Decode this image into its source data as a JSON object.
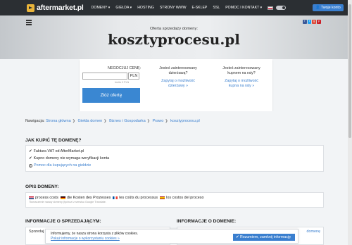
{
  "nav": {
    "logo_text": "aftermarket.pl",
    "menu": [
      "DOMENY",
      "GIEŁDA",
      "HOSTING",
      "STRONY WWW",
      "E-SKLEP",
      "SSL",
      "POMOC I KONTAKT"
    ],
    "login_label": "Twoje konto"
  },
  "hero": {
    "subtitle": "Oferta sprzedaży domeny:",
    "domain": "kosztyprocesu.pl"
  },
  "offer": {
    "price_label": "NEGOCJUJ CENĘ:",
    "price_value": "",
    "currency": "PLN",
    "price_note": "brutto 0 PLN",
    "submit_label": "Złóż ofertę",
    "lease": {
      "text_1": "Jesteś zainteresowany",
      "text_2": "dzierżawą?",
      "link_1": "Zapytaj o możliwość",
      "link_2": "dzierżawy »"
    },
    "installments": {
      "text_1": "Jesteś zainteresowany",
      "text_2": "kupnem na raty?",
      "link_1": "Zapytaj o możliwość",
      "link_2": "kupna na raty »"
    }
  },
  "breadcrumb": {
    "label": "Nawigacja:",
    "items": [
      "Strona główna",
      "Giełda domen",
      "Biznes i Gospodarka",
      "Prawo",
      "kosztyprocesu.pl"
    ]
  },
  "how_to_buy": {
    "title": "JAK KUPIĆ TĘ DOMENĘ?",
    "features": [
      "Faktura VAT od AfterMarket.pl",
      "Kupno domeny nie wymaga weryfikacji konta"
    ],
    "help_link": "Pomoc dla kupujących na giełdzie"
  },
  "description": {
    "title": "OPIS DOMENY:",
    "items": [
      "process costs",
      "die Kosten des Prozesses",
      "les coûts du processus",
      "los costos del proceso"
    ],
    "note": "Tłumaczenie nazwy domeny (tychozi z serwisu Google Translate."
  },
  "seller": {
    "title": "INFORMACJE O SPRZEDAJĄCYM:",
    "partial": "Sprzedaj"
  },
  "domain_info": {
    "title": "INFORMACJE O DOMENIE:",
    "partial": "domenę",
    "partial_2": "Wiek dom"
  },
  "cookie": {
    "line_1": "Informujemy, że nasza strona korzysta z plików cookies.",
    "link": "Pokaż informacje o wykorzystaniu cookies »",
    "accept_label": "Rozumiem, zamknij informację"
  },
  "colors": {
    "nav_bg": "#2b2f33",
    "accent": "#3a7fcf",
    "logo_accent": "#e9b43a"
  }
}
